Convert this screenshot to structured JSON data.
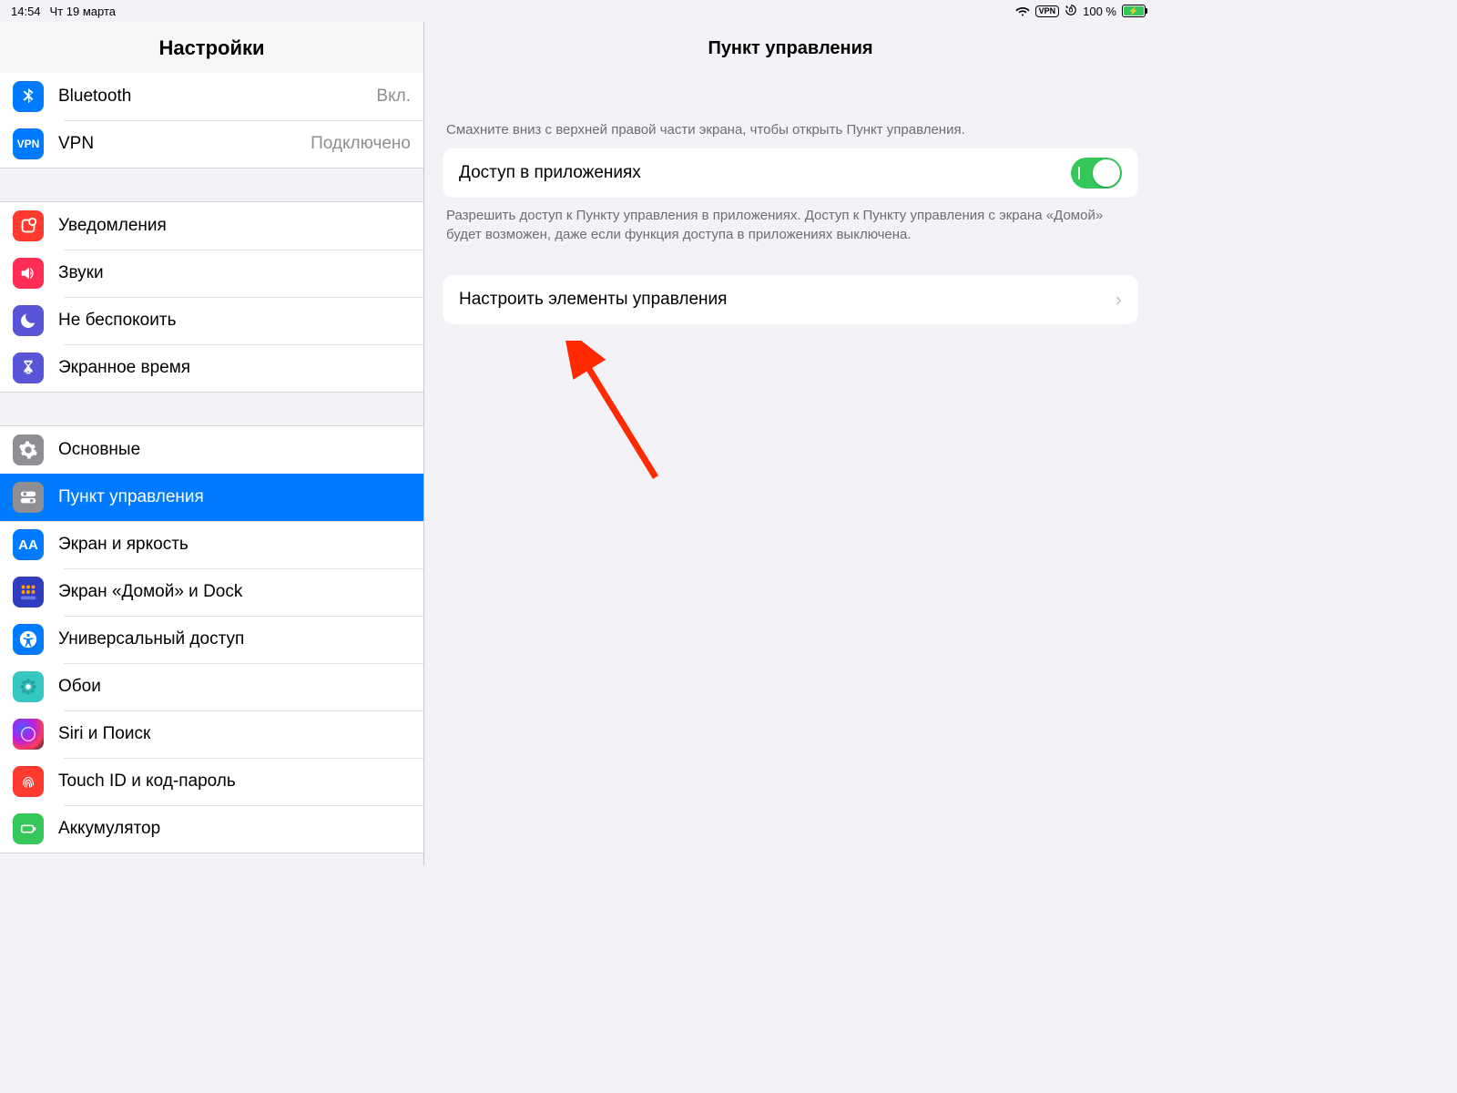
{
  "status": {
    "time": "14:54",
    "date": "Чт 19 марта",
    "vpn_badge": "VPN",
    "battery_text": "100 %"
  },
  "sidebar": {
    "title": "Настройки",
    "group1": [
      {
        "label": "Bluetooth",
        "value": "Вкл.",
        "icon": "bluetooth",
        "bg": "#007aff"
      },
      {
        "label": "VPN",
        "value": "Подключено",
        "icon": "vpn",
        "bg": "#007aff"
      }
    ],
    "group2": [
      {
        "label": "Уведомления",
        "icon": "notifications",
        "bg": "#ff3b30"
      },
      {
        "label": "Звуки",
        "icon": "sounds",
        "bg": "#ff2d55"
      },
      {
        "label": "Не беспокоить",
        "icon": "dnd",
        "bg": "#5856d6"
      },
      {
        "label": "Экранное время",
        "icon": "screentime",
        "bg": "#5856d6"
      }
    ],
    "group3": [
      {
        "label": "Основные",
        "icon": "general",
        "bg": "#8e8e93"
      },
      {
        "label": "Пункт управления",
        "icon": "control-center",
        "bg": "#8e8e93",
        "selected": true
      },
      {
        "label": "Экран и яркость",
        "icon": "display",
        "bg": "#007aff"
      },
      {
        "label": "Экран «Домой» и Dock",
        "icon": "home",
        "bg": "#2f3cc0"
      },
      {
        "label": "Универсальный доступ",
        "icon": "accessibility",
        "bg": "#007aff"
      },
      {
        "label": "Обои",
        "icon": "wallpaper",
        "bg": "#35c7c2"
      },
      {
        "label": "Siri и Поиск",
        "icon": "siri",
        "bg": "#1c1c1e"
      },
      {
        "label": "Touch ID и код-пароль",
        "icon": "touchid",
        "bg": "#ff3b30"
      },
      {
        "label": "Аккумулятор",
        "icon": "battery",
        "bg": "#34c759"
      }
    ]
  },
  "detail": {
    "title": "Пункт управления",
    "hint": "Смахните вниз с верхней правой части экрана, чтобы открыть Пункт управления.",
    "access_label": "Доступ в приложениях",
    "access_on": true,
    "access_foot": "Разрешить доступ к Пункту управления в приложениях. Доступ к Пункту управления с экрана «Домой» будет возможен, даже если функция доступа в приложениях выключена.",
    "customize_label": "Настроить элементы управления"
  },
  "colors": {
    "accent": "#007aff",
    "toggle_on": "#34c759",
    "arrow": "#ff2a00"
  }
}
